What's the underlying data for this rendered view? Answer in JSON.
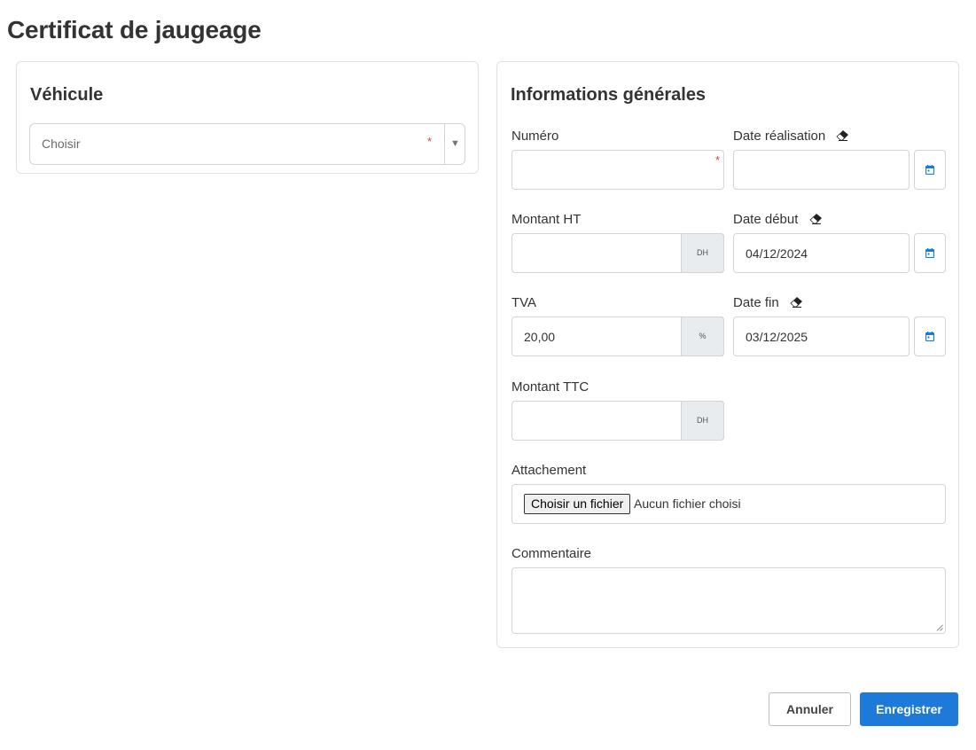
{
  "page": {
    "title": "Certificat de jaugeage"
  },
  "vehicule": {
    "title": "Véhicule",
    "select": {
      "placeholder": "Choisir",
      "required_mark": "*"
    }
  },
  "info": {
    "title": "Informations générales",
    "numero": {
      "label": "Numéro",
      "value": "",
      "required_mark": "*"
    },
    "date_realisation": {
      "label": "Date réalisation",
      "value": ""
    },
    "montant_ht": {
      "label": "Montant HT",
      "value": "",
      "unit": "DH"
    },
    "date_debut": {
      "label": "Date début",
      "value": "04/12/2024"
    },
    "tva": {
      "label": "TVA",
      "value": "20,00",
      "unit": "%"
    },
    "date_fin": {
      "label": "Date fin",
      "value": "03/12/2025"
    },
    "montant_ttc": {
      "label": "Montant TTC",
      "value": "",
      "unit": "DH"
    },
    "attachement": {
      "label": "Attachement",
      "button_label": "Choisir un fichier",
      "status": "Aucun fichier choisi"
    },
    "commentaire": {
      "label": "Commentaire",
      "value": ""
    }
  },
  "actions": {
    "cancel_label": "Annuler",
    "save_label": "Enregistrer"
  },
  "colors": {
    "primary": "#1e7ad8",
    "required": "#e0413c",
    "addon_bg": "#e9ecef",
    "calendar_icon": "#1e7ad8"
  },
  "icons": {
    "clear_date": "eraser-icon",
    "calendar": "calendar-icon",
    "dropdown": "caret-down-icon"
  }
}
